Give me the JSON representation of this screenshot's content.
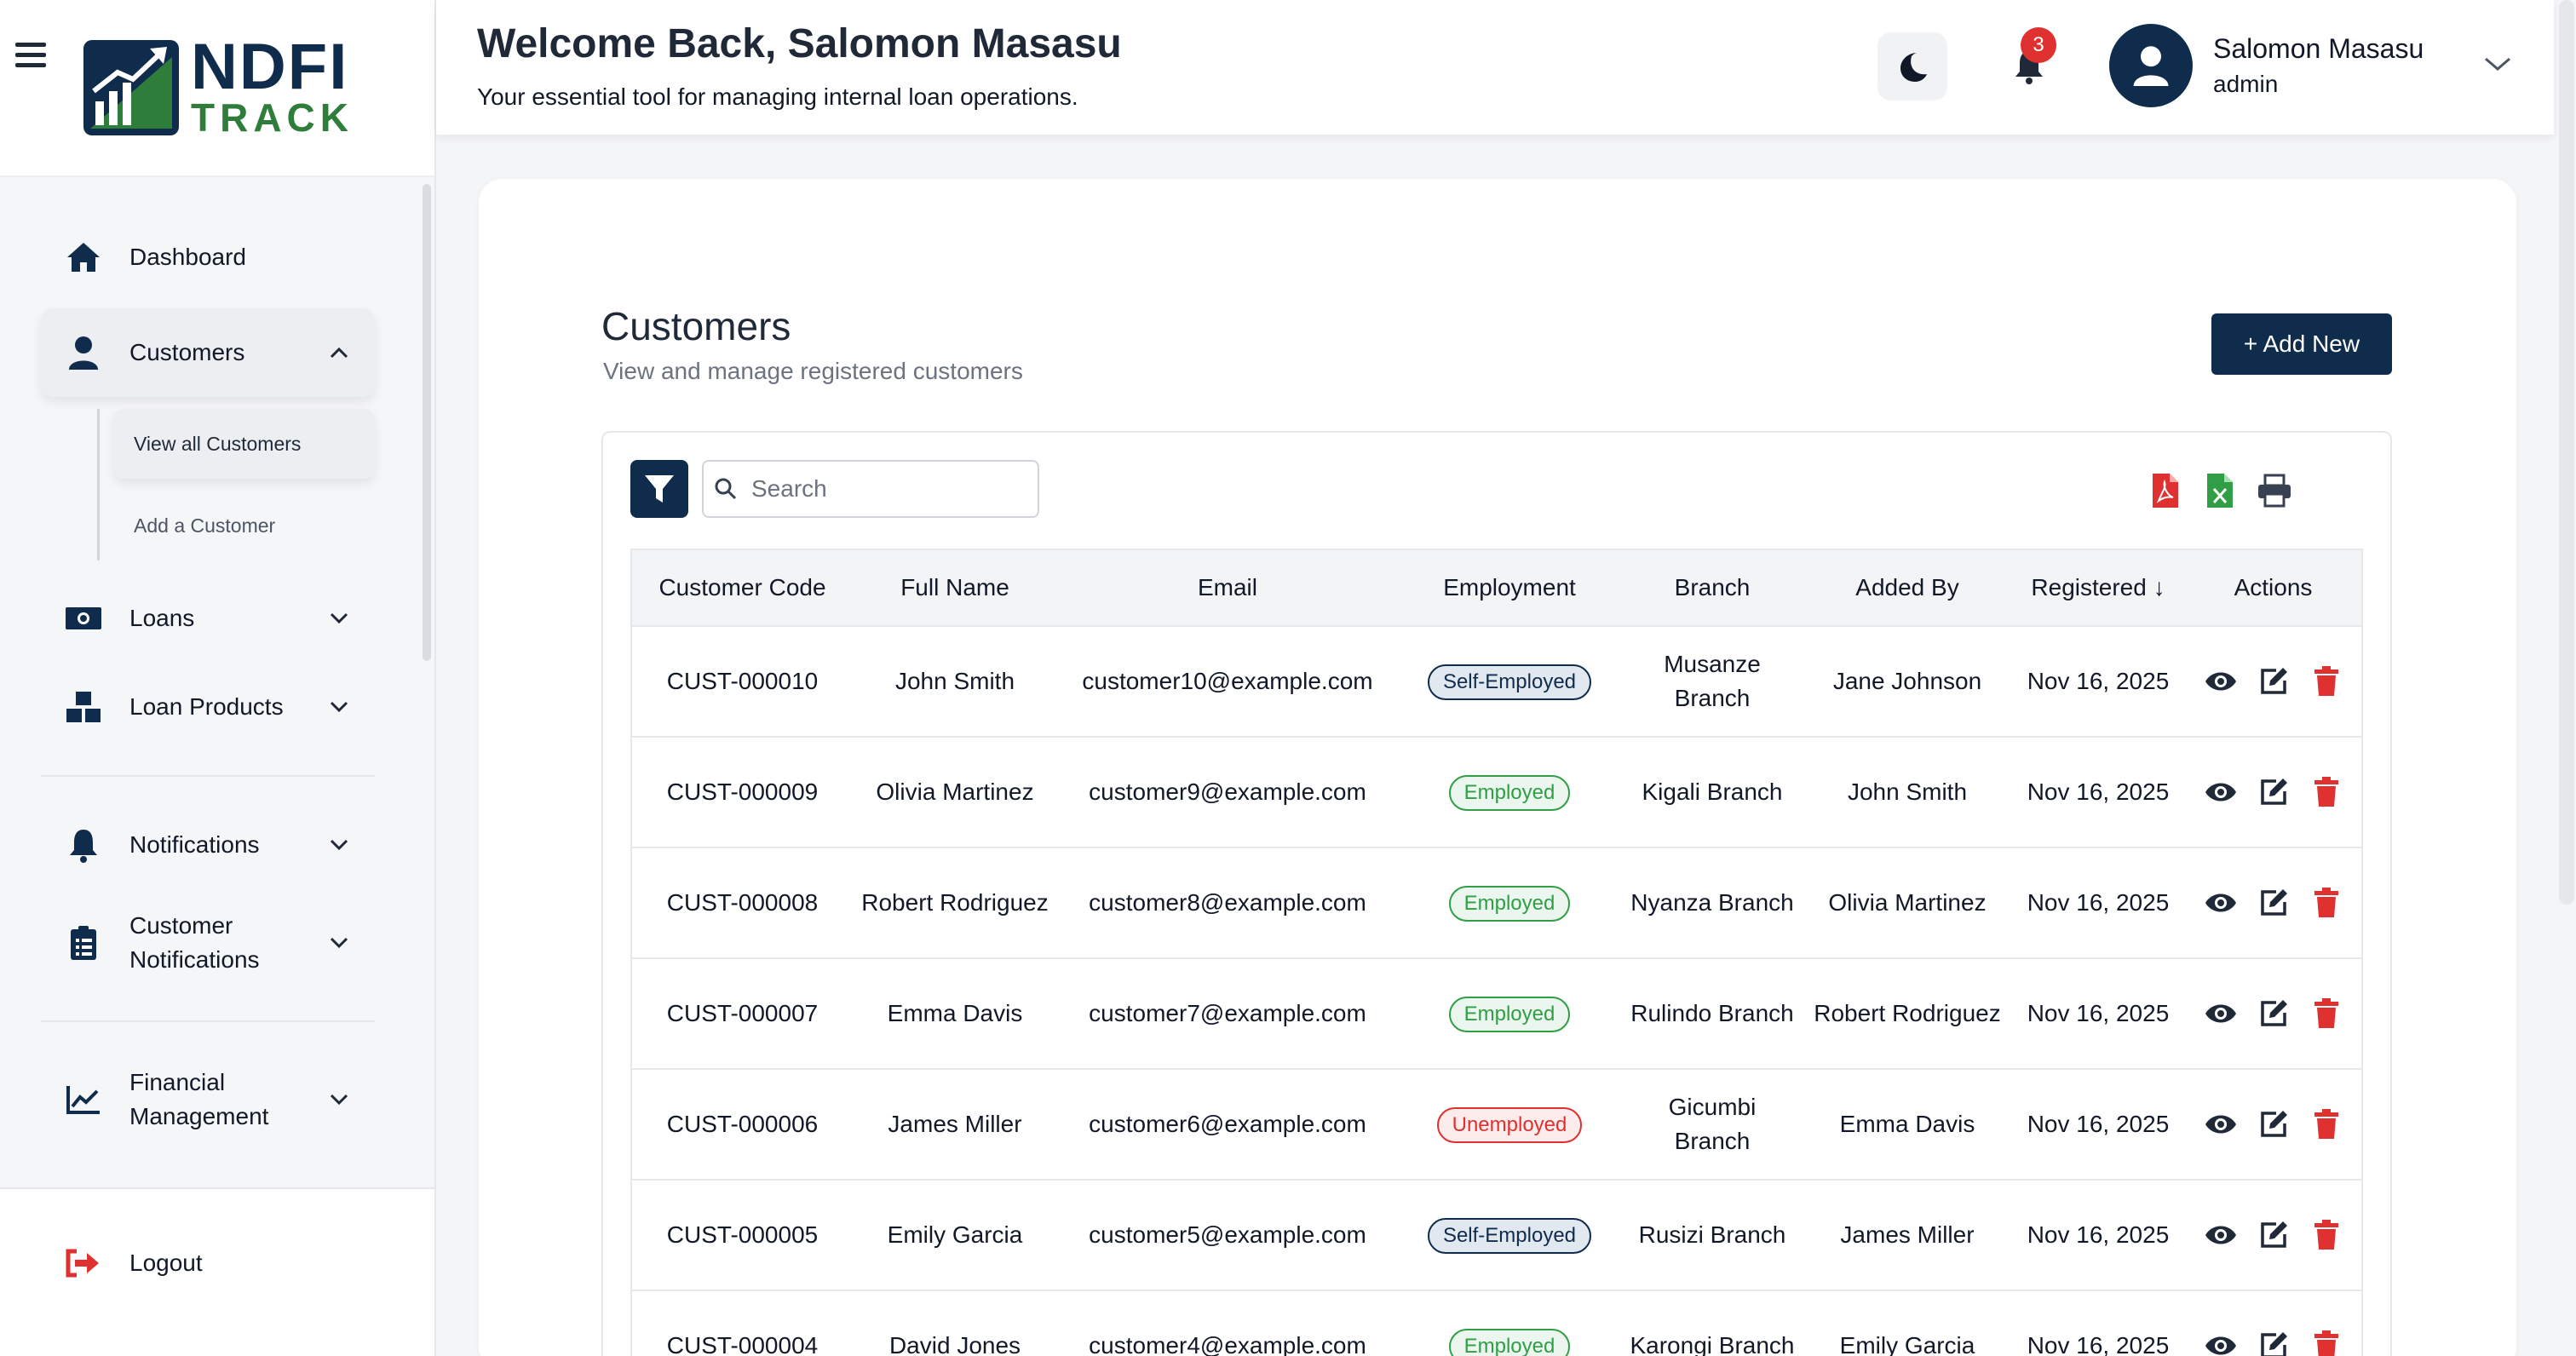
{
  "brand": {
    "line1": "NDFI",
    "line2": "TRACK"
  },
  "header": {
    "welcome": "Welcome Back, Salomon Masasu",
    "tagline": "Your essential tool for managing internal loan operations.",
    "notification_count": "3",
    "user_name": "Salomon Masasu",
    "user_role": "admin"
  },
  "sidebar": {
    "items": [
      {
        "label": "Dashboard",
        "icon": "home-icon"
      },
      {
        "label": "Customers",
        "icon": "user-icon"
      },
      {
        "label": "Loans",
        "icon": "money-icon"
      },
      {
        "label": "Loan Products",
        "icon": "boxes-icon"
      },
      {
        "label": "Notifications",
        "icon": "bell-icon"
      },
      {
        "label": "Customer Notifications",
        "icon": "clipboard-icon"
      },
      {
        "label": "Financial Management",
        "icon": "chart-line-icon"
      }
    ],
    "sub_items": [
      {
        "label": "View all Customers"
      },
      {
        "label": "Add a Customer"
      }
    ],
    "logout": "Logout"
  },
  "main": {
    "title": "Customers",
    "subtitle": "View and manage registered customers",
    "add_button": "+ Add New",
    "search_placeholder": "Search",
    "columns": [
      "Customer Code",
      "Full Name",
      "Email",
      "Employment",
      "Branch",
      "Added By",
      "Registered ↓",
      "Actions"
    ],
    "rows": [
      {
        "code": "CUST-000010",
        "name": "John Smith",
        "email": "customer10@example.com",
        "employment": "Self-Employed",
        "branch": "Musanze Branch",
        "added_by": "Jane Johnson",
        "registered": "Nov 16, 2025"
      },
      {
        "code": "CUST-000009",
        "name": "Olivia Martinez",
        "email": "customer9@example.com",
        "employment": "Employed",
        "branch": "Kigali Branch",
        "added_by": "John Smith",
        "registered": "Nov 16, 2025"
      },
      {
        "code": "CUST-000008",
        "name": "Robert Rodriguez",
        "email": "customer8@example.com",
        "employment": "Employed",
        "branch": "Nyanza Branch",
        "added_by": "Olivia Martinez",
        "registered": "Nov 16, 2025"
      },
      {
        "code": "CUST-000007",
        "name": "Emma Davis",
        "email": "customer7@example.com",
        "employment": "Employed",
        "branch": "Rulindo Branch",
        "added_by": "Robert Rodriguez",
        "registered": "Nov 16, 2025"
      },
      {
        "code": "CUST-000006",
        "name": "James Miller",
        "email": "customer6@example.com",
        "employment": "Unemployed",
        "branch": "Gicumbi Branch",
        "added_by": "Emma Davis",
        "registered": "Nov 16, 2025"
      },
      {
        "code": "CUST-000005",
        "name": "Emily Garcia",
        "email": "customer5@example.com",
        "employment": "Self-Employed",
        "branch": "Rusizi Branch",
        "added_by": "James Miller",
        "registered": "Nov 16, 2025"
      },
      {
        "code": "CUST-000004",
        "name": "David Jones",
        "email": "customer4@example.com",
        "employment": "Employed",
        "branch": "Karongi Branch",
        "added_by": "Emily Garcia",
        "registered": "Nov 16, 2025"
      }
    ]
  },
  "colors": {
    "primary": "#0f2c4c",
    "brand_green": "#2f7d3a",
    "danger": "#e03131",
    "success": "#2f9e44"
  }
}
